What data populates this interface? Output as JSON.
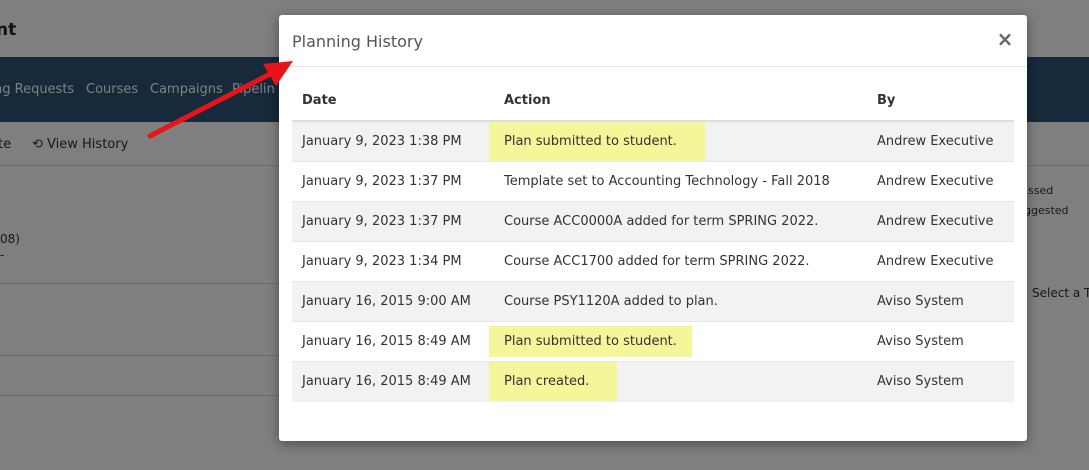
{
  "background": {
    "title_fragment": "nt",
    "nav_items": [
      "ng Requests",
      "Courses",
      "Campaigns",
      "Pipelin"
    ],
    "toolbar": {
      "left_fragment": "te",
      "view_history_label": "View History"
    },
    "left_fragments": [
      "08)",
      "-"
    ],
    "right_fragments": [
      "ssed",
      "ggested",
      "Select a T"
    ]
  },
  "modal": {
    "title": "Planning History",
    "close_label": "×",
    "columns": [
      "Date",
      "Action",
      "By"
    ],
    "rows": [
      {
        "date": "January 9, 2023 1:38 PM",
        "action": "Plan submitted to student.",
        "by": "Andrew Executive",
        "highlighted": true
      },
      {
        "date": "January 9, 2023 1:37 PM",
        "action": "Template set to Accounting Technology - Fall 2018",
        "by": "Andrew Executive",
        "highlighted": false
      },
      {
        "date": "January 9, 2023 1:37 PM",
        "action": "Course ACC0000A added for term SPRING 2022.",
        "by": "Andrew Executive",
        "highlighted": false
      },
      {
        "date": "January 9, 2023 1:34 PM",
        "action": "Course ACC1700 added for term SPRING 2022.",
        "by": "Andrew Executive",
        "highlighted": false
      },
      {
        "date": "January 16, 2015 9:00 AM",
        "action": "Course PSY1120A added to plan.",
        "by": "Aviso System",
        "highlighted": false
      },
      {
        "date": "January 16, 2015 8:49 AM",
        "action": "Plan submitted to student.",
        "by": "Aviso System",
        "highlighted": true
      },
      {
        "date": "January 16, 2015 8:49 AM",
        "action": "Plan created.",
        "by": "Aviso System",
        "highlighted": true
      }
    ]
  },
  "annotation": {
    "arrow_color": "#e8141a",
    "highlight_color": "#f5f59a"
  }
}
